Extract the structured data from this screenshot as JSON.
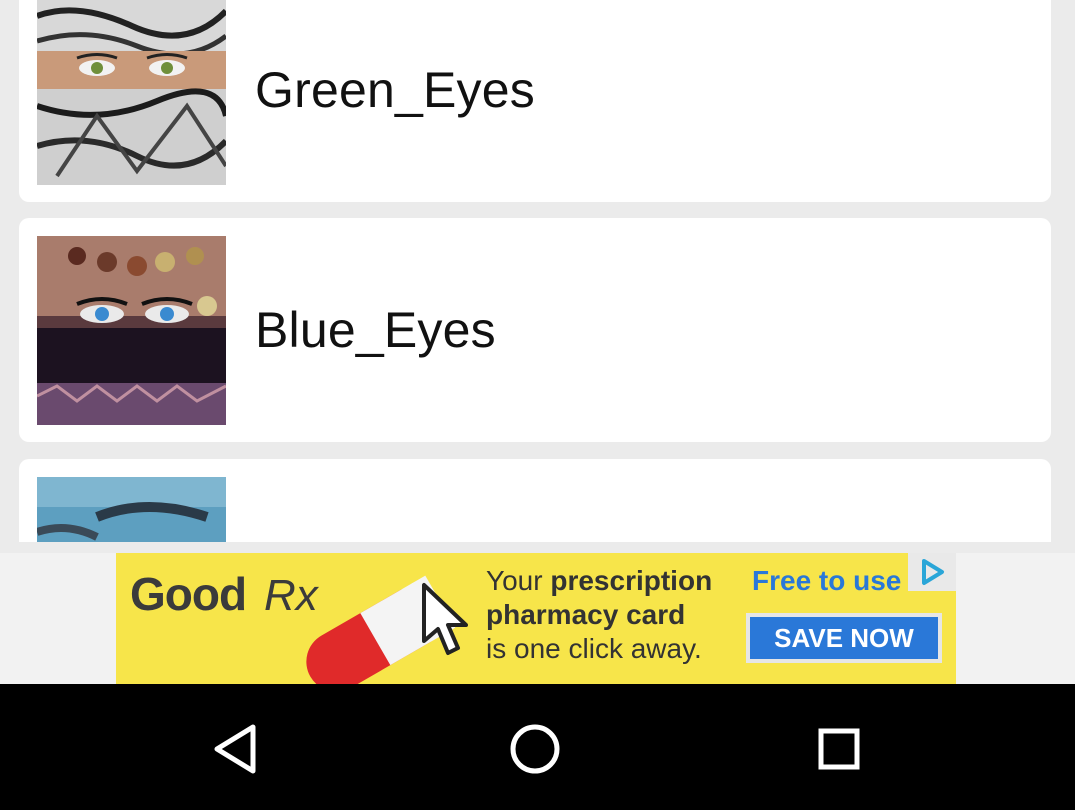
{
  "list": {
    "items": [
      {
        "label": "Green_Eyes",
        "thumbnail": "woman-green-eyes-keffiyeh-photo"
      },
      {
        "label": "Blue_Eyes",
        "thumbnail": "woman-blue-eyes-veil-photo"
      },
      {
        "label": "",
        "thumbnail": "blue-eye-closeup-photo"
      }
    ]
  },
  "ad": {
    "brand": "Good",
    "brand_rx": "Rx",
    "line1_prefix": "Your ",
    "line1_bold": "prescription",
    "line2": "pharmacy card",
    "line3": "is one click away.",
    "free_text": "Free to use",
    "cta": "SAVE NOW",
    "background_color": "#f7e54a",
    "accent_color": "#2a78d8",
    "adchoices_icon": "play-triangle-icon"
  },
  "navbar": {
    "back_icon": "back-triangle-icon",
    "home_icon": "home-circle-icon",
    "recents_icon": "recents-square-icon"
  }
}
